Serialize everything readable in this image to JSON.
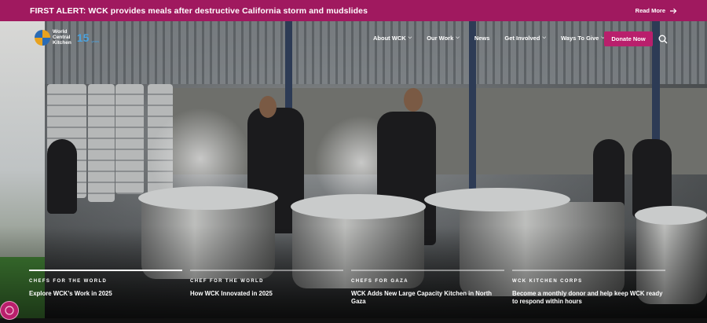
{
  "alert": {
    "text": "FIRST ALERT: WCK provides meals after destructive California storm and mudslides",
    "link_label": "Read More"
  },
  "logo": {
    "line1": "World",
    "line2": "Central",
    "line3": "Kitchen",
    "badge": "15",
    "badge_sub": "years"
  },
  "nav": {
    "items": [
      {
        "label": "About WCK",
        "has_dropdown": true
      },
      {
        "label": "Our Work",
        "has_dropdown": true
      },
      {
        "label": "News",
        "has_dropdown": false
      },
      {
        "label": "Get Involved",
        "has_dropdown": true
      },
      {
        "label": "Ways To Give",
        "has_dropdown": true
      }
    ],
    "donate_label": "Donate Now"
  },
  "slides": [
    {
      "category": "CHEFS FOR THE WORLD",
      "title": "Explore WCK’s Work in 2025",
      "active": true
    },
    {
      "category": "CHEF FOR THE WORLD",
      "title": "How WCK Innovated in 2025",
      "active": false
    },
    {
      "category": "CHEFS FOR GAZA",
      "title": "WCK Adds New Large Capacity Kitchen in North Gaza",
      "active": false
    },
    {
      "category": "WCK KITCHEN CORPS",
      "title": "Become a monthly donor and help keep WCK ready to respond within hours",
      "active": false
    }
  ],
  "colors": {
    "alert_bg": "#a0195f",
    "donate_bg": "#b91f6c",
    "logo_accent": "#4aa3e0"
  }
}
